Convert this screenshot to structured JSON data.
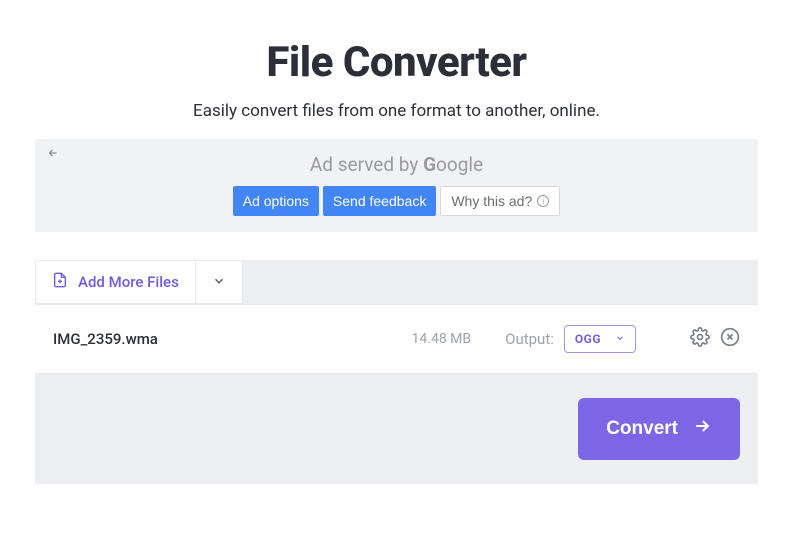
{
  "header": {
    "title": "File Converter",
    "subtitle": "Easily convert files from one format to another, online."
  },
  "ad": {
    "served_text": "Ad served by ",
    "brand": "Google",
    "options_label": "Ad options",
    "feedback_label": "Send feedback",
    "why_label": "Why this ad?"
  },
  "toolbar": {
    "add_more_label": "Add More Files"
  },
  "file": {
    "name": "IMG_2359.wma",
    "size": "14.48 MB",
    "output_label": "Output:",
    "format": "OGG"
  },
  "action": {
    "convert_label": "Convert"
  }
}
